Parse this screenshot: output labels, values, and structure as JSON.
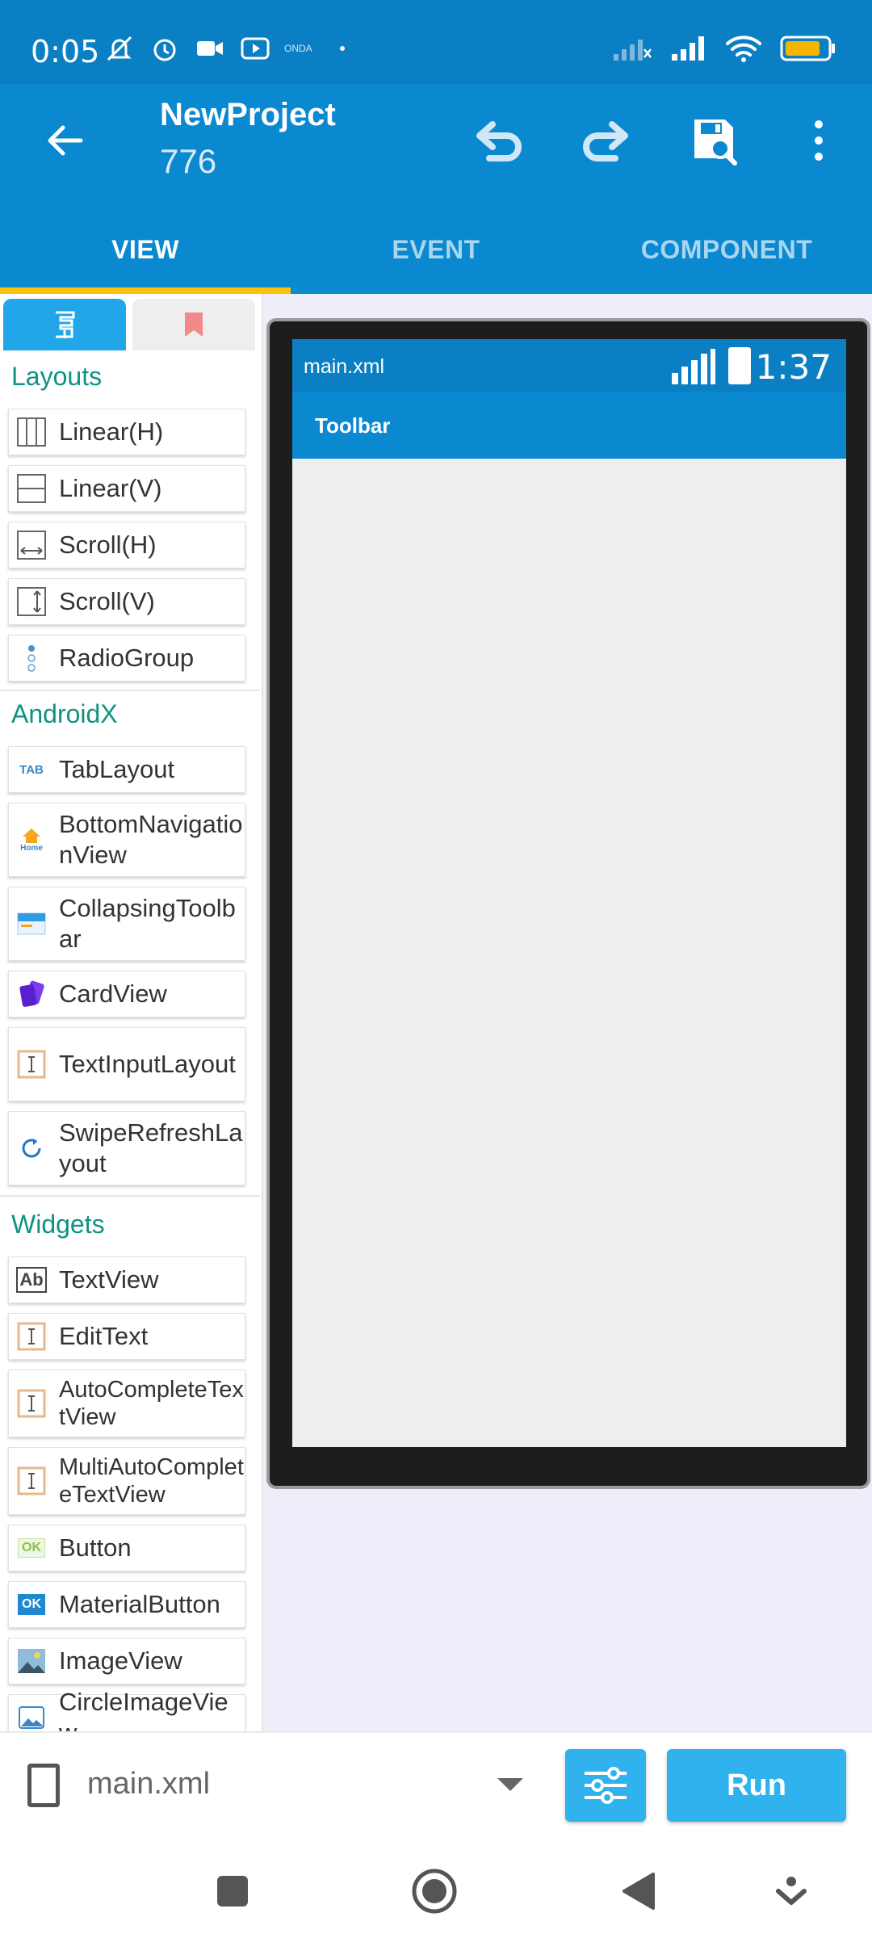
{
  "status_bar": {
    "time": "0:05",
    "provider_text": "ONDA"
  },
  "app_bar": {
    "title": "NewProject",
    "subtitle": "776"
  },
  "tabs": [
    {
      "label": "VIEW",
      "active": true
    },
    {
      "label": "EVENT",
      "active": false
    },
    {
      "label": "COMPONENT",
      "active": false
    }
  ],
  "palette": {
    "sections": {
      "layouts": "Layouts",
      "androidx": "AndroidX",
      "widgets": "Widgets"
    },
    "layouts": [
      "Linear(H)",
      "Linear(V)",
      "Scroll(H)",
      "Scroll(V)",
      "RadioGroup"
    ],
    "androidx": [
      "TabLayout",
      "BottomNavigationView",
      "CollapsingToolbar",
      "CardView",
      "TextInputLayout",
      "SwipeRefreshLayout"
    ],
    "widgets": [
      "TextView",
      "EditText",
      "AutoCompleteTextView",
      "MultiAutoCompleteTextView",
      "Button",
      "MaterialButton",
      "ImageView",
      "CircleImageView"
    ],
    "icon_labels": {
      "tab": "TAB",
      "home": "Home",
      "ab": "Ab",
      "ok": "OK"
    }
  },
  "preview": {
    "file": "main.xml",
    "time": "1:37",
    "toolbar_title": "Toolbar"
  },
  "bottom_bar": {
    "file": "main.xml",
    "run_label": "Run"
  },
  "colors": {
    "primary": "#0a88d0",
    "status": "#0a7fc4",
    "accent": "#ffc107",
    "section_title": "#0f9283",
    "button": "#30b2ef"
  }
}
